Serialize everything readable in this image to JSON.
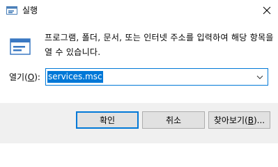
{
  "window": {
    "title": "실행",
    "app_icon": "run-icon",
    "close_icon": "close-icon"
  },
  "content": {
    "description": "프로그램, 폴더, 문서, 또는 인터넷 주소를 입력하여 해당 항목을 열 수 있습니다.",
    "big_icon": "run-dialog-icon"
  },
  "open_field": {
    "label_prefix": "열기(",
    "label_accel": "O",
    "label_suffix": "):",
    "value": "services.msc"
  },
  "buttons": {
    "ok": "확인",
    "cancel": "취소",
    "browse_prefix": "찾아보기(",
    "browse_accel": "B",
    "browse_suffix": ")..."
  },
  "colors": {
    "accent": "#0078d7",
    "panel": "#f0f0f0",
    "button_face": "#e1e1e1"
  }
}
